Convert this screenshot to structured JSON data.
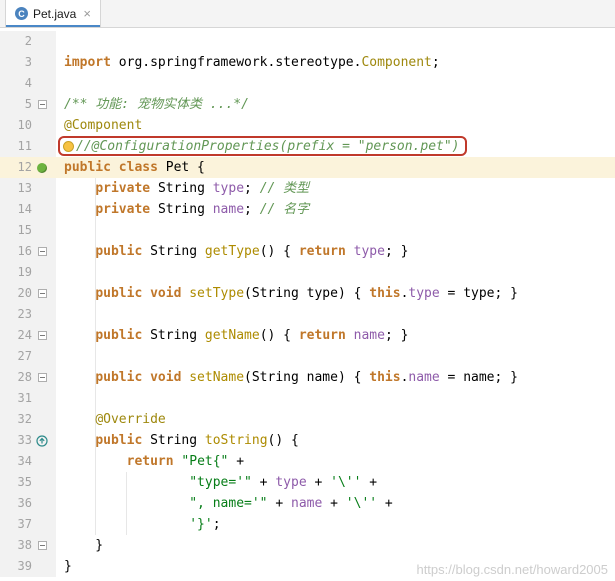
{
  "tab": {
    "title": "Pet.java",
    "close": "×",
    "file_icon": "java-class-icon"
  },
  "watermark": "https://blog.csdn.net/howard2005",
  "colors": {
    "keyword": "#C0772A",
    "plain": "#000000",
    "annotation": "#9E880D",
    "comment": "#629755",
    "doc_comment": "#629755",
    "string": "#067D17",
    "field": "#8E5BAA",
    "method": "#AD8B00",
    "caret_row": "#FBF3DB",
    "red_box": "#C0392B",
    "gutter_bg": "#F2F2F2",
    "line_number": "#A3A3A3",
    "watermark": "#CDCDCD",
    "tab_underline": "#4A88C7",
    "bean_green": "#6DB33F",
    "override_teal": "#2E8B8B",
    "bulb_yellow": "#F7C242"
  },
  "editor": {
    "lines": [
      {
        "n": "2",
        "tk": []
      },
      {
        "n": "3",
        "tk": [
          {
            "t": "import ",
            "c": "kw"
          },
          {
            "t": "org.springframework.stereotype.",
            "c": "pl"
          },
          {
            "t": "Component",
            "c": "ann"
          },
          {
            "t": ";",
            "c": "pl"
          }
        ]
      },
      {
        "n": "4",
        "tk": []
      },
      {
        "n": "5",
        "fold": true,
        "tk": [
          {
            "t": "/** 功能: 宠物实体类 ...*/",
            "c": "doc"
          }
        ]
      },
      {
        "n": "10",
        "tk": [
          {
            "t": "@Component",
            "c": "ann"
          }
        ]
      },
      {
        "n": "11",
        "bulb": true,
        "box": true,
        "tk": [
          {
            "t": "//@ConfigurationProperties(prefix = \"person.pet\")",
            "c": "cm"
          }
        ]
      },
      {
        "n": "12",
        "caret": true,
        "icon": "bean",
        "tk": [
          {
            "t": "public class ",
            "c": "kw"
          },
          {
            "t": "Pet {",
            "c": "pl"
          }
        ]
      },
      {
        "n": "13",
        "tk": [
          {
            "t": "    ",
            "c": "pl"
          },
          {
            "t": "private ",
            "c": "kw"
          },
          {
            "t": "String ",
            "c": "pl"
          },
          {
            "t": "type",
            "c": "fld"
          },
          {
            "t": "; ",
            "c": "pl"
          },
          {
            "t": "// 类型",
            "c": "cm"
          }
        ]
      },
      {
        "n": "14",
        "tk": [
          {
            "t": "    ",
            "c": "pl"
          },
          {
            "t": "private ",
            "c": "kw"
          },
          {
            "t": "String ",
            "c": "pl"
          },
          {
            "t": "name",
            "c": "fld"
          },
          {
            "t": "; ",
            "c": "pl"
          },
          {
            "t": "// 名字",
            "c": "cm"
          }
        ]
      },
      {
        "n": "15",
        "tk": []
      },
      {
        "n": "16",
        "fold": true,
        "tk": [
          {
            "t": "    ",
            "c": "pl"
          },
          {
            "t": "public ",
            "c": "kw"
          },
          {
            "t": "String ",
            "c": "pl"
          },
          {
            "t": "getType",
            "c": "mth"
          },
          {
            "t": "() { ",
            "c": "pl"
          },
          {
            "t": "return ",
            "c": "kw"
          },
          {
            "t": "type",
            "c": "fld"
          },
          {
            "t": "; }",
            "c": "pl"
          }
        ]
      },
      {
        "n": "19",
        "tk": []
      },
      {
        "n": "20",
        "fold": true,
        "tk": [
          {
            "t": "    ",
            "c": "pl"
          },
          {
            "t": "public void ",
            "c": "kw"
          },
          {
            "t": "setType",
            "c": "mth"
          },
          {
            "t": "(String type) { ",
            "c": "pl"
          },
          {
            "t": "this",
            "c": "kw"
          },
          {
            "t": ".",
            "c": "pl"
          },
          {
            "t": "type",
            "c": "fld"
          },
          {
            "t": " = type; }",
            "c": "pl"
          }
        ]
      },
      {
        "n": "23",
        "tk": []
      },
      {
        "n": "24",
        "fold": true,
        "tk": [
          {
            "t": "    ",
            "c": "pl"
          },
          {
            "t": "public ",
            "c": "kw"
          },
          {
            "t": "String ",
            "c": "pl"
          },
          {
            "t": "getName",
            "c": "mth"
          },
          {
            "t": "() { ",
            "c": "pl"
          },
          {
            "t": "return ",
            "c": "kw"
          },
          {
            "t": "name",
            "c": "fld"
          },
          {
            "t": "; }",
            "c": "pl"
          }
        ]
      },
      {
        "n": "27",
        "tk": []
      },
      {
        "n": "28",
        "fold": true,
        "tk": [
          {
            "t": "    ",
            "c": "pl"
          },
          {
            "t": "public void ",
            "c": "kw"
          },
          {
            "t": "setName",
            "c": "mth"
          },
          {
            "t": "(String name) { ",
            "c": "pl"
          },
          {
            "t": "this",
            "c": "kw"
          },
          {
            "t": ".",
            "c": "pl"
          },
          {
            "t": "name",
            "c": "fld"
          },
          {
            "t": " = name; }",
            "c": "pl"
          }
        ]
      },
      {
        "n": "31",
        "tk": []
      },
      {
        "n": "32",
        "tk": [
          {
            "t": "    ",
            "c": "pl"
          },
          {
            "t": "@Override",
            "c": "ann"
          }
        ]
      },
      {
        "n": "33",
        "icon": "override",
        "tk": [
          {
            "t": "    ",
            "c": "pl"
          },
          {
            "t": "public ",
            "c": "kw"
          },
          {
            "t": "String ",
            "c": "pl"
          },
          {
            "t": "toString",
            "c": "mth"
          },
          {
            "t": "() {",
            "c": "pl"
          }
        ]
      },
      {
        "n": "34",
        "tk": [
          {
            "t": "        ",
            "c": "pl"
          },
          {
            "t": "return ",
            "c": "kw"
          },
          {
            "t": "\"Pet{\"",
            "c": "str"
          },
          {
            "t": " +",
            "c": "pl"
          }
        ]
      },
      {
        "n": "35",
        "tk": [
          {
            "t": "                ",
            "c": "pl"
          },
          {
            "t": "\"type='\"",
            "c": "str"
          },
          {
            "t": " + ",
            "c": "pl"
          },
          {
            "t": "type",
            "c": "fld"
          },
          {
            "t": " + ",
            "c": "pl"
          },
          {
            "t": "'\\''",
            "c": "str"
          },
          {
            "t": " +",
            "c": "pl"
          }
        ]
      },
      {
        "n": "36",
        "tk": [
          {
            "t": "                ",
            "c": "pl"
          },
          {
            "t": "\", name='\"",
            "c": "str"
          },
          {
            "t": " + ",
            "c": "pl"
          },
          {
            "t": "name",
            "c": "fld"
          },
          {
            "t": " + ",
            "c": "pl"
          },
          {
            "t": "'\\''",
            "c": "str"
          },
          {
            "t": " +",
            "c": "pl"
          }
        ]
      },
      {
        "n": "37",
        "tk": [
          {
            "t": "                ",
            "c": "pl"
          },
          {
            "t": "'}'",
            "c": "str"
          },
          {
            "t": ";",
            "c": "pl"
          }
        ]
      },
      {
        "n": "38",
        "fold": true,
        "tk": [
          {
            "t": "    }",
            "c": "pl"
          }
        ]
      },
      {
        "n": "39",
        "tk": [
          {
            "t": "}",
            "c": "pl"
          }
        ]
      }
    ]
  }
}
